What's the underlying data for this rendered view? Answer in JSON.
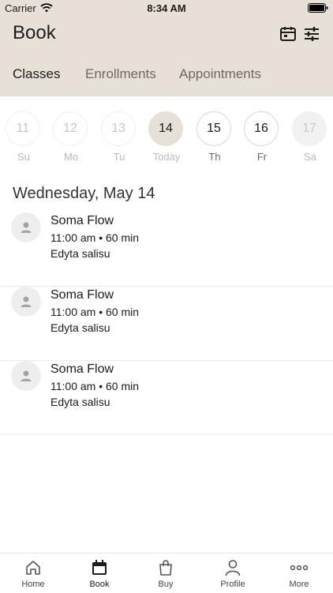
{
  "status_bar": {
    "carrier": "Carrier",
    "time": "8:34 AM"
  },
  "header": {
    "title": "Book"
  },
  "tabs": [
    {
      "label": "Classes",
      "active": true
    },
    {
      "label": "Enrollments",
      "active": false
    },
    {
      "label": "Appointments",
      "active": false
    }
  ],
  "days": [
    {
      "num": "11",
      "label": "Su",
      "state": "past"
    },
    {
      "num": "12",
      "label": "Mo",
      "state": "past"
    },
    {
      "num": "13",
      "label": "Tu",
      "state": "past"
    },
    {
      "num": "14",
      "label": "Today",
      "state": "today"
    },
    {
      "num": "15",
      "label": "Th",
      "state": "future"
    },
    {
      "num": "16",
      "label": "Fr",
      "state": "future"
    },
    {
      "num": "17",
      "label": "Sa",
      "state": "disabled"
    }
  ],
  "date_heading": "Wednesday, May 14",
  "classes": [
    {
      "name": "Soma Flow",
      "time": "11:00 am • 60 min",
      "teacher": "Edyta salisu"
    },
    {
      "name": "Soma Flow",
      "time": "11:00 am • 60 min",
      "teacher": "Edyta salisu"
    },
    {
      "name": "Soma Flow",
      "time": "11:00 am • 60 min",
      "teacher": "Edyta salisu"
    }
  ],
  "tabbar": [
    {
      "label": "Home",
      "icon": "home-icon"
    },
    {
      "label": "Book",
      "icon": "calendar-icon"
    },
    {
      "label": "Buy",
      "icon": "shopping-bag-icon"
    },
    {
      "label": "Profile",
      "icon": "person-icon"
    },
    {
      "label": "More",
      "icon": "more-dots-icon"
    }
  ]
}
